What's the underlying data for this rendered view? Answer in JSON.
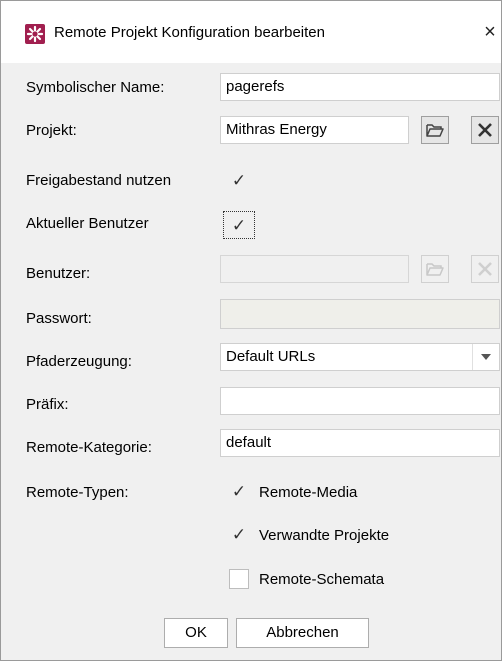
{
  "window": {
    "title": "Remote Projekt Konfiguration bearbeiten",
    "close_glyph": "×"
  },
  "labels": {
    "symbolic_name": "Symbolischer Name:",
    "project": "Projekt:",
    "use_release": "Freigabestand nutzen",
    "current_user": "Aktueller Benutzer",
    "user": "Benutzer:",
    "password": "Passwort:",
    "path_generation": "Pfaderzeugung:",
    "prefix": "Präfix:",
    "remote_category": "Remote-Kategorie:",
    "remote_types": "Remote-Typen:"
  },
  "values": {
    "symbolic_name": "pagerefs",
    "project": "Mithras Energy",
    "user": "",
    "password": "",
    "path_generation": "Default URLs",
    "prefix": "",
    "remote_category": "default"
  },
  "checkboxes": {
    "use_release": true,
    "current_user": true,
    "check_glyph": "✓"
  },
  "remote_types": [
    {
      "label": "Remote-Media",
      "checked": true
    },
    {
      "label": "Verwandte Projekte",
      "checked": true
    },
    {
      "label": "Remote-Schemata",
      "checked": false
    }
  ],
  "buttons": {
    "ok": "OK",
    "cancel": "Abbrechen"
  },
  "icons": {
    "app": "app-icon",
    "browse": "folder-open-icon",
    "clear": "close-icon",
    "dropdown": "chevron-down-icon"
  },
  "colors": {
    "accent": "#a11f4f",
    "window_bg": "#f0f0f0",
    "title_bg": "#ffffff"
  }
}
